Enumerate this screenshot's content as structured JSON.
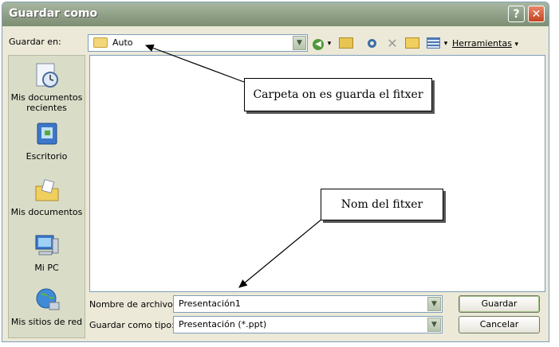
{
  "window": {
    "title": "Guardar como",
    "help": "?",
    "close": "✕"
  },
  "toolbar": {
    "save_in_label": "Guardar en:",
    "location_value": "Auto",
    "tools_label": "Herramientas",
    "tools_arrow": "▾",
    "back_arrow": "▾"
  },
  "places": [
    {
      "label": "Mis documentos recientes",
      "icon": "recent-documents-icon"
    },
    {
      "label": "Escritorio",
      "icon": "desktop-icon"
    },
    {
      "label": "Mis documentos",
      "icon": "my-documents-icon"
    },
    {
      "label": "Mi PC",
      "icon": "my-computer-icon"
    },
    {
      "label": "Mis sitios de red",
      "icon": "network-places-icon"
    }
  ],
  "form": {
    "filename_label": "Nombre de archivo:",
    "filename_value": "Presentación1",
    "filetype_label": "Guardar como tipo:",
    "filetype_value": "Presentación (*.ppt)"
  },
  "buttons": {
    "save": "Guardar",
    "cancel": "Cancelar"
  },
  "annotations": {
    "folder_callout": "Carpeta on es guarda el fitxer",
    "name_callout": "Nom del fitxer"
  },
  "colors": {
    "title_bar": "#8f9f86",
    "close_button": "#d0532b",
    "dialog_bg": "#ece9d8",
    "places_bg": "#d9dcc7"
  }
}
